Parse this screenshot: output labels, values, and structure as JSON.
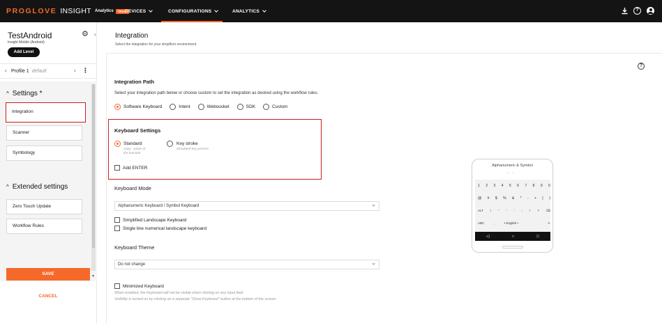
{
  "app": {
    "brand": "PROGLOVE",
    "brand_insight": "INSIGHT",
    "brand_analytics": "Analytics",
    "brand_badge": "TRIAL",
    "nav": [
      "DEVICES",
      "CONFIGURATIONS",
      "ANALYTICS"
    ],
    "icons": [
      "download-icon",
      "help-icon",
      "user-icon"
    ],
    "colors": {
      "accent": "#f5692a",
      "topbar": "#141414",
      "highlight": "#cc1b1b"
    }
  },
  "sidebar": {
    "project_title": "TestAndroid",
    "project_subtitle": "Insight Mobile (Android)",
    "add_level": "Add Level",
    "profile_name": "Profile 1",
    "profile_default": "default",
    "settings_header": "Settings *",
    "settings_items": [
      "Integration",
      "Scanner",
      "Symbology"
    ],
    "extended_header": "Extended settings",
    "extended_items": [
      "Zero Touch Update",
      "Workflow Rules"
    ],
    "save": "SAVE",
    "cancel": "CANCEL"
  },
  "main": {
    "title": "Integration",
    "subtitle": "Select the integration for your shopfloor environment.",
    "integration_path": {
      "heading": "Integration Path",
      "description": "Select your integration path below or choose custom to set the integration as desired using the workflow rules.",
      "options": [
        "Software Keyboard",
        "Intent",
        "Websocket",
        "SDK",
        "Custom"
      ],
      "selected": "Software Keyboard"
    },
    "keyboard_settings": {
      "heading": "Keyboard Settings",
      "standard_label": "Standard",
      "standard_hint_1": "Copy - paste of",
      "standard_hint_2": "the barcode",
      "keystroke_label": "Key stroke",
      "keystroke_hint": "Simulated key presses",
      "selected": "Standard",
      "add_enter": "Add ENTER"
    },
    "keyboard_mode": {
      "heading": "Keyboard Mode",
      "value": "Alphanumeric Keyboard / Symbol Keyboard",
      "simplified_landscape": "Simplified Landscape Keyboard",
      "single_line_numerical": "Single line numerical landscape keyboard"
    },
    "keyboard_theme": {
      "heading": "Keyboard Theme",
      "value": "Do not change"
    },
    "minimized": {
      "label": "Minimized Keyboard",
      "note_1": "When enabled, the Keyboard will not be visible when clicking on any input field.",
      "note_2": "Visibility is turned on by clicking on a separate \"Show Keyboard\" button at the bottom of the screen."
    },
    "phone_preview": {
      "title": "Alphanumeric & Symbol",
      "row1": [
        "1",
        "2",
        "3",
        "4",
        "5",
        "6",
        "7",
        "8",
        "9",
        "0"
      ],
      "row2": [
        "@",
        "#",
        "$",
        "%",
        "&",
        "*",
        "-",
        "+",
        "(",
        ")"
      ],
      "row3": [
        "ALT",
        "!",
        "\"",
        "'",
        ":",
        ";",
        "/",
        "?",
        "⌫"
      ],
      "row4": [
        "ABC",
        ",",
        "• English •",
        "",
        ".",
        "↵"
      ],
      "nav": [
        "◁",
        "○",
        "□"
      ]
    }
  }
}
